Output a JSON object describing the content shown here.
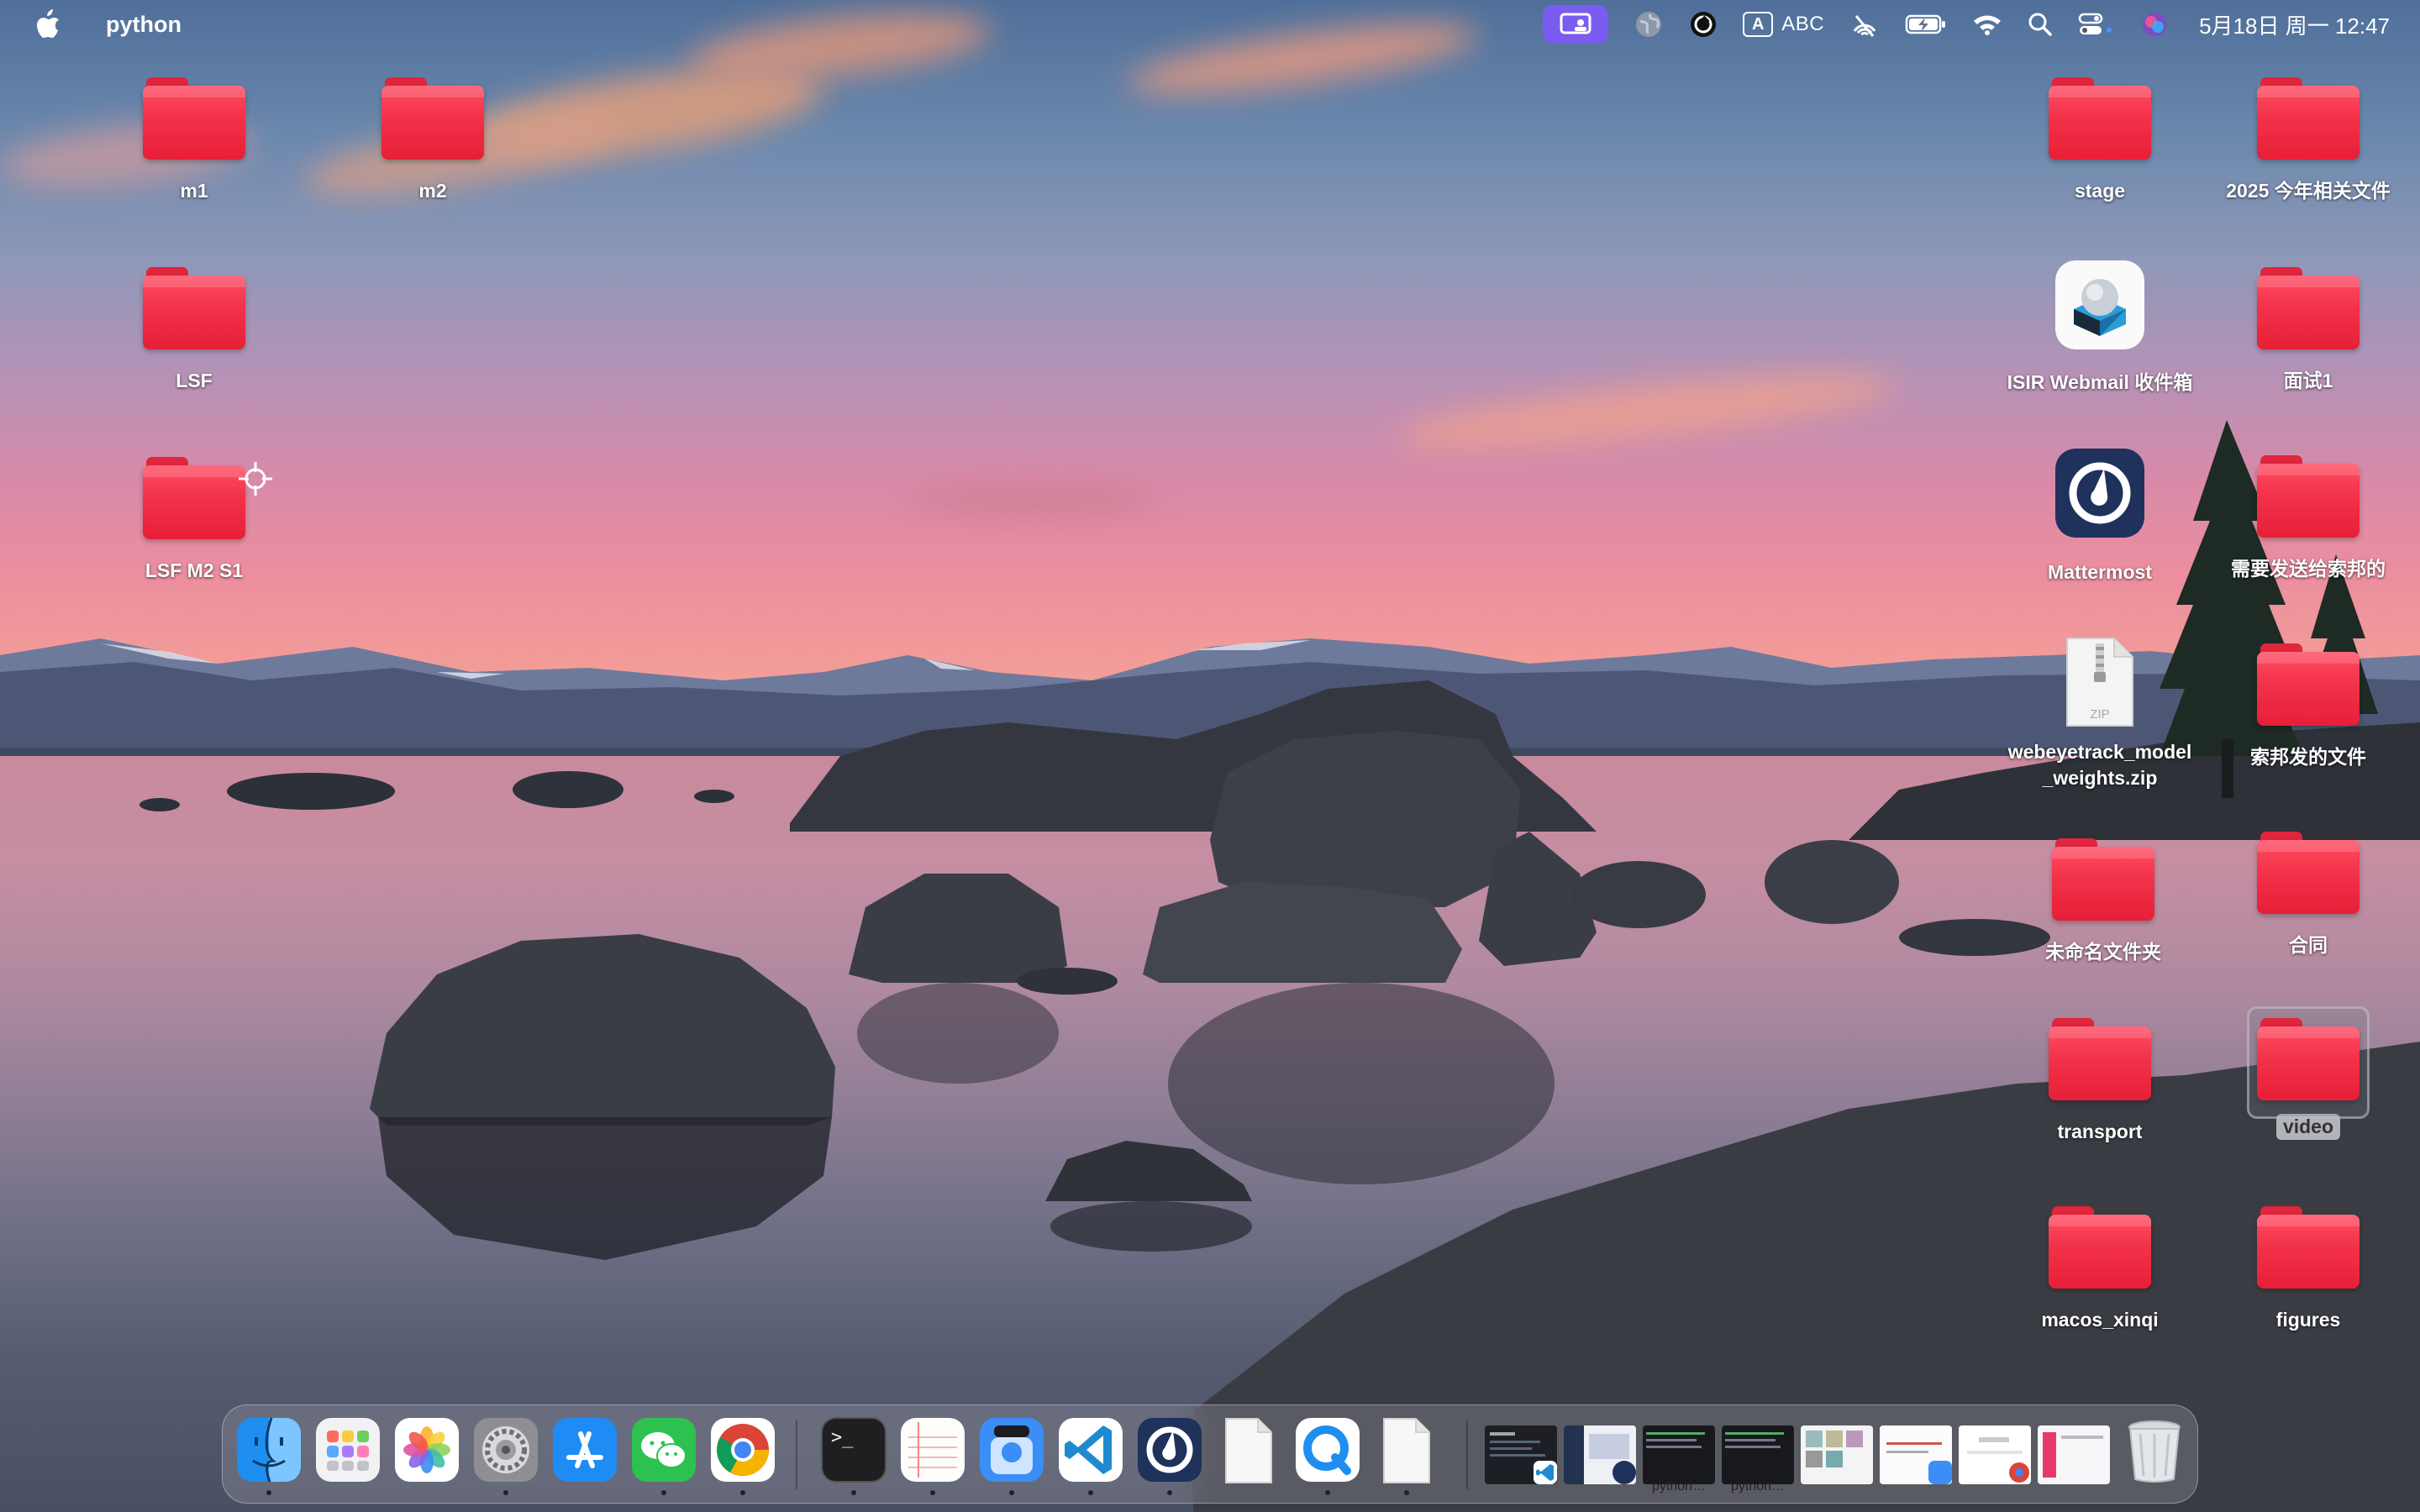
{
  "menubar": {
    "app_name": "python",
    "input_source": "ABC",
    "input_box_letter": "A",
    "clock": "5月18日 周一  12:47",
    "accent_color": "#7a5cf0"
  },
  "desktop": {
    "left_items": [
      {
        "label": "m1",
        "type": "folder"
      },
      {
        "label": "m2",
        "type": "folder"
      },
      {
        "label": "LSF",
        "type": "folder"
      },
      {
        "label": "LSF M2 S1",
        "type": "folder"
      }
    ],
    "right_items": [
      {
        "label": "stage",
        "type": "folder"
      },
      {
        "label": "2025 今年相关文件",
        "type": "folder"
      },
      {
        "label": "ISIR Webmail  收件箱",
        "type": "app"
      },
      {
        "label": "面试1",
        "type": "folder"
      },
      {
        "label": "Mattermost",
        "type": "app"
      },
      {
        "label": "需要发送给索邦的",
        "type": "folder"
      },
      {
        "label": "webeyetrack_model_weights.zip",
        "type": "zip",
        "badge": "ZIP"
      },
      {
        "label": "索邦发的文件",
        "type": "folder"
      },
      {
        "label": "未命名文件夹",
        "type": "folder"
      },
      {
        "label": "合同",
        "type": "folder"
      },
      {
        "label": "transport",
        "type": "folder"
      },
      {
        "label": "video",
        "type": "folder",
        "selected": true
      },
      {
        "label": "macos_xinqi",
        "type": "folder"
      },
      {
        "label": "figures",
        "type": "folder"
      }
    ],
    "folder_color": "#f23148"
  },
  "dock": {
    "apps": [
      {
        "name": "finder-icon"
      },
      {
        "name": "launchpad-icon"
      },
      {
        "name": "photos-icon"
      },
      {
        "name": "system-settings-icon"
      },
      {
        "name": "app-store-icon"
      },
      {
        "name": "wechat-icon"
      },
      {
        "name": "chrome-icon"
      },
      {
        "name": "terminal-icon"
      },
      {
        "name": "notes-icon"
      },
      {
        "name": "preview-icon"
      },
      {
        "name": "vscode-icon"
      },
      {
        "name": "mattermost-icon"
      },
      {
        "name": "document-icon"
      },
      {
        "name": "quicktime-icon"
      },
      {
        "name": "document-icon"
      }
    ],
    "terminal_prompt": ">_",
    "windows": [
      {
        "label": ""
      },
      {
        "label": ""
      },
      {
        "label": "python…"
      },
      {
        "label": "python…"
      },
      {
        "label": ""
      },
      {
        "label": ""
      },
      {
        "label": ""
      },
      {
        "label": ""
      }
    ],
    "trash": "trash-icon"
  }
}
